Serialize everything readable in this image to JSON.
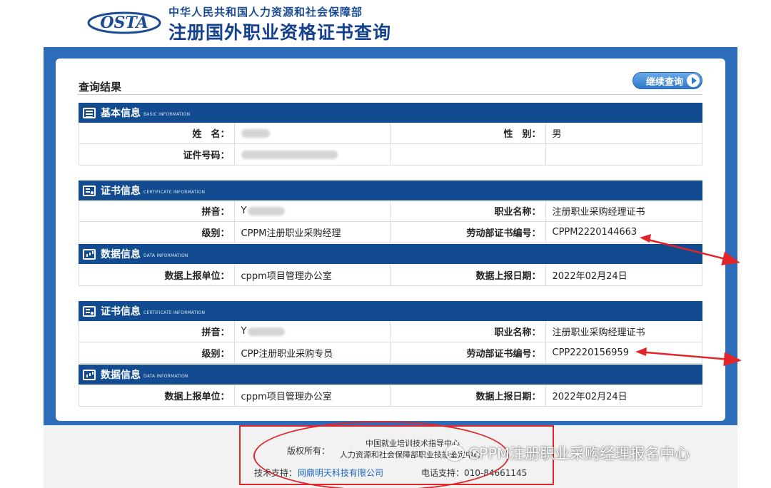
{
  "header": {
    "logo_text": "OSTA",
    "org_line": "中华人民共和国人力资源和社会保障部",
    "site_title": "注册国外职业资格证书查询"
  },
  "result": {
    "title": "查询结果",
    "continue_label": "继续查询"
  },
  "basic": {
    "title": "基本信息",
    "subtitle": "BASIC INFORMATION",
    "name_label": "姓　名：",
    "gender_label": "性　别：",
    "gender_value": "男",
    "id_label": "证件号码："
  },
  "certificates": [
    {
      "title": "证书信息",
      "subtitle": "CERTIFICATE INFORMATION",
      "pinyin_label": "拼音：",
      "pinyin_value": "Y",
      "occupation_label": "职业名称：",
      "occupation_value": "注册职业采购经理证书",
      "level_label": "级别：",
      "level_value": "CPPM注册职业采购经理",
      "cert_no_label": "劳动部证书编号：",
      "cert_no_value": "CPPM2220144663",
      "data_title": "数据信息",
      "data_subtitle": "DATA INFORMATION",
      "unit_label": "数据上报单位：",
      "unit_value": "cppm项目管理办公室",
      "date_label": "数据上报日期：",
      "date_value": "2022年02月24日"
    },
    {
      "title": "证书信息",
      "subtitle": "CERTIFICATE INFORMATION",
      "pinyin_label": "拼音：",
      "pinyin_value": "Y",
      "occupation_label": "职业名称：",
      "occupation_value": "注册职业采购经理证书",
      "level_label": "级别：",
      "level_value": "CPP注册职业采购专员",
      "cert_no_label": "劳动部证书编号：",
      "cert_no_value": "CPP2220156959",
      "data_title": "数据信息",
      "data_subtitle": "DATA INFORMATION",
      "unit_label": "数据上报单位：",
      "unit_value": "cppm项目管理办公室",
      "date_label": "数据上报日期：",
      "date_value": "2022年02月24日"
    }
  ],
  "footer": {
    "copyright_label": "版权所有：",
    "copyright_line1": "中国就业培训技术指导中心",
    "copyright_line2": "人力资源和社会保障部职业技能鉴定中心",
    "tech_label": "技术支持：",
    "tech_link": "网鼎明天科技有限公司",
    "phone": "电话支持：010-84661145"
  },
  "watermark": "CPPM注册职业采购经理报名中心",
  "colors": {
    "section_bar": "#124b8f",
    "frame": "#2d6cb8",
    "annotation": "#e0262a",
    "link": "#1a66c2"
  }
}
